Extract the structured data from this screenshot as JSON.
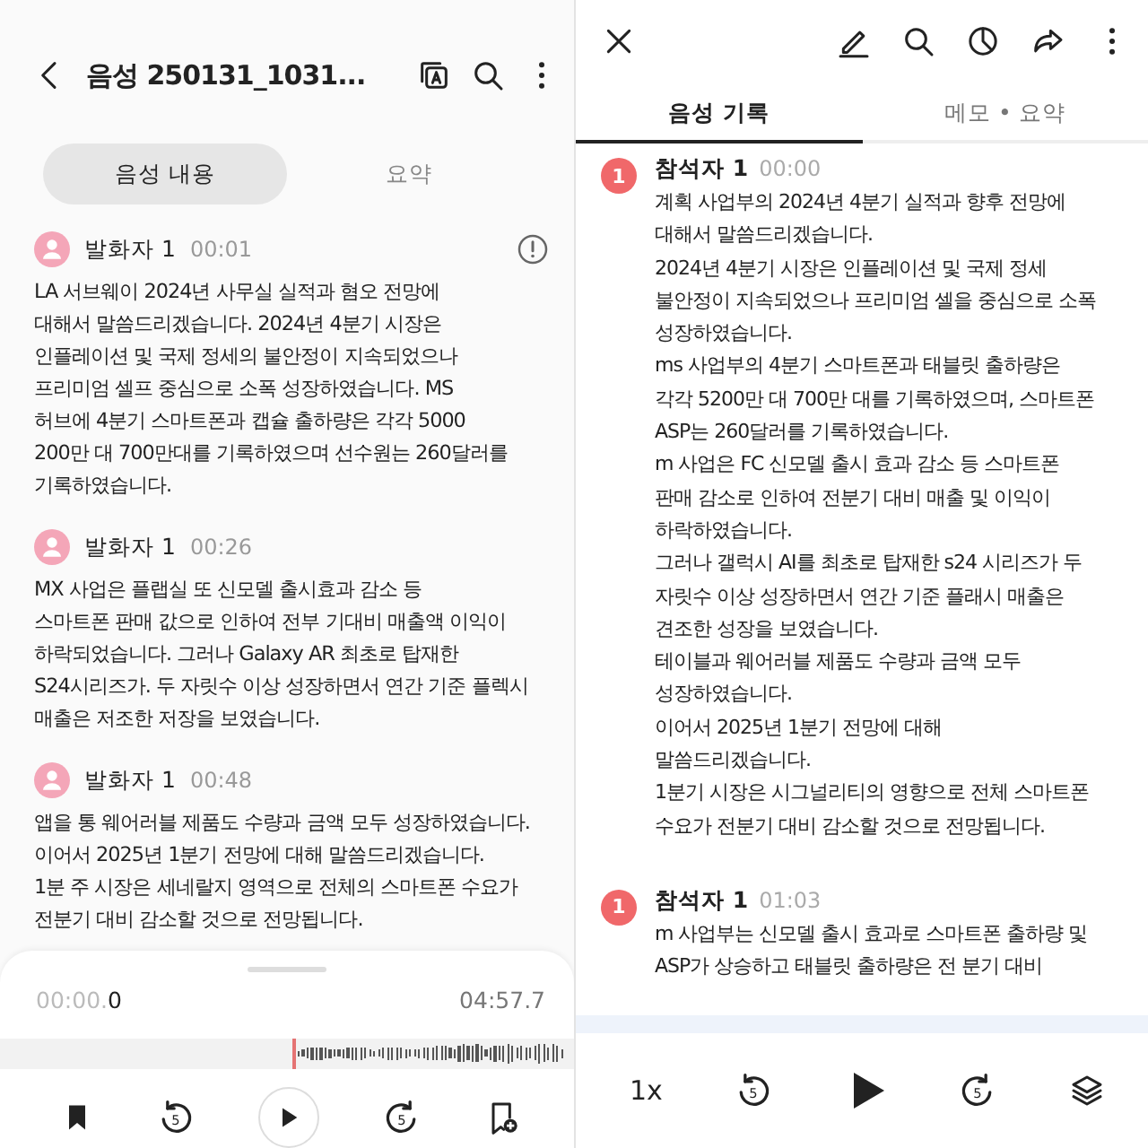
{
  "left": {
    "header": {
      "title": "음성 250131_1031..."
    },
    "tabs": [
      {
        "label": "음성 내용",
        "selected": true
      },
      {
        "label": "요약",
        "selected": false
      }
    ],
    "segments": [
      {
        "speaker": "발화자 1",
        "time": "00:01",
        "flagged": true,
        "text": "LA 서브웨이 2024년 사무실 실적과 혐오 전망에\n대해서 말씀드리겠습니다. 2024년 4분기 시장은\n인플레이션 및 국제 정세의 불안정이 지속되었으나\n프리미엄 셀프 중심으로 소폭 성장하였습니다. MS\n허브에 4분기 스마트폰과 캡슐 출하량은 각각 5000\n200만 대 700만대를 기록하였으며 선수원는 260달러를\n기록하였습니다."
      },
      {
        "speaker": "발화자 1",
        "time": "00:26",
        "flagged": false,
        "text": "MX 사업은 플랩실 또 신모델 출시효과 감소 등\n스마트폰 판매 값으로 인하여 전부 기대비 매출액 이익이\n하락되었습니다. 그러나 Galaxy AR 최초로 탑재한\nS24시리즈가. 두 자릿수 이상 성장하면서 연간 기준 플렉시\n매출은 저조한 저장을 보였습니다."
      },
      {
        "speaker": "발화자 1",
        "time": "00:48",
        "flagged": false,
        "text": "앱을 통 웨어러블 제품도 수량과 금액 모두 성장하였습니다.\n이어서 2025년 1분기 전망에 대해 말씀드리겠습니다.\n1분 주 시장은 세네랄지 영역으로 전체의 스마트폰 수요가\n전분기 대비 감소할 것으로 전망됩니다."
      }
    ],
    "player": {
      "elapsed": "00:00.**0**",
      "total": "04:57.7",
      "rewind_label": "5",
      "forward_label": "5"
    }
  },
  "right": {
    "tabs": [
      {
        "label": "음성 기록",
        "selected": true
      },
      {
        "label": "메모 • 요약",
        "selected": false
      }
    ],
    "entries": [
      {
        "badge": "1",
        "speaker": "참석자 1",
        "time": "00:00",
        "text": "계획 사업부의 2024년 4분기 실적과 향후 전망에\n대해서 말씀드리겠습니다.\n2024년 4분기 시장은 인플레이션 및 국제 정세\n불안정이 지속되었으나 프리미엄 셀을 중심으로 소폭\n성장하였습니다.\nms 사업부의 4분기 스마트폰과 태블릿 출하량은\n각각 5200만 대 700만 대를 기록하였으며, 스마트폰\nASP는 260달러를 기록하였습니다.\nm 사업은 FC 신모델 출시 효과 감소 등 스마트폰\n판매 감소로 인하여 전분기 대비 매출 및 이익이\n하락하였습니다.\n그러나 갤럭시 AI를 최초로 탑재한 s24 시리즈가 두\n자릿수 이상 성장하면서 연간 기준 플래시 매출은\n견조한 성장을 보였습니다.\n테이블과 웨어러블 제품도 수량과 금액 모두\n성장하였습니다.\n이어서 2025년 1분기 전망에 대해\n말씀드리겠습니다.\n1분기 시장은 시그널리티의 영향으로 전체 스마트폰\n수요가 전분기 대비 감소할 것으로 전망됩니다."
      },
      {
        "badge": "1",
        "speaker": "참석자 1",
        "time": "01:03",
        "text": "m 사업부는 신모델 출시 효과로 스마트폰 출하량 및\nASP가 상승하고 태블릿 출하량은 전 분기 대비"
      }
    ],
    "player": {
      "speed": "1x",
      "rewind_label": "5",
      "forward_label": "5"
    }
  }
}
